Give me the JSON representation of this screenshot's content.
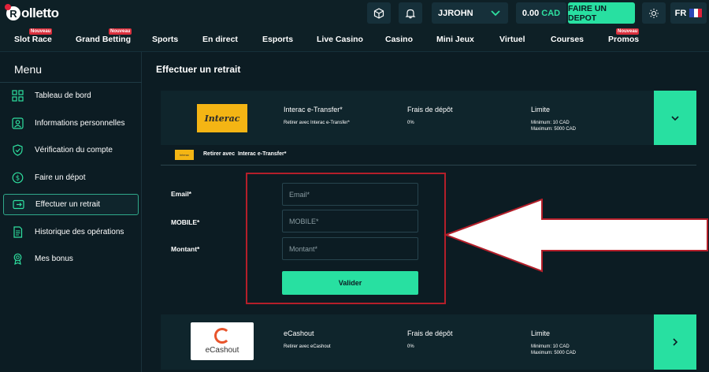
{
  "brand": {
    "logo_letter": "R",
    "logo_text": "olletto"
  },
  "topbar": {
    "username": "JJROHN",
    "balance_amount": "0.00",
    "balance_currency": "CAD",
    "deposit_label": "FAIRE UN DEPOT",
    "language": "FR"
  },
  "nav": {
    "items": [
      {
        "label": "Slot Race",
        "badge": "Nouveau"
      },
      {
        "label": "Grand Betting",
        "badge": "Nouveau"
      },
      {
        "label": "Sports"
      },
      {
        "label": "En direct"
      },
      {
        "label": "Esports"
      },
      {
        "label": "Live Casino"
      },
      {
        "label": "Casino"
      },
      {
        "label": "Mini Jeux"
      },
      {
        "label": "Virtuel"
      },
      {
        "label": "Courses"
      },
      {
        "label": "Promos",
        "badge": "Nouveau"
      }
    ]
  },
  "sidebar": {
    "title": "Menu",
    "items": [
      {
        "label": "Tableau de bord",
        "icon": "dashboard-icon"
      },
      {
        "label": "Informations personnelles",
        "icon": "profile-icon"
      },
      {
        "label": "Vérification du compte",
        "icon": "shield-check-icon"
      },
      {
        "label": "Faire un dépot",
        "icon": "dollar-circle-icon"
      },
      {
        "label": "Effectuer un retrait",
        "icon": "withdraw-icon",
        "active": true
      },
      {
        "label": "Historique des opérations",
        "icon": "history-icon"
      },
      {
        "label": "Mes bonus",
        "icon": "bonus-medal-icon"
      }
    ]
  },
  "main": {
    "title": "Effectuer un retrait",
    "methods": [
      {
        "logo_text": "Interac",
        "name": "Interac e-Transfer*",
        "sub": "Retirer avec Interac e-Transfer*",
        "fee_title": "Frais de dépôt",
        "fee_value": "0%",
        "limit_title": "Limite",
        "limit_min": "Minimum: 10 CAD",
        "limit_max": "Maximum: 5000 CAD",
        "expanded": true
      },
      {
        "logo_text": "eCashout",
        "name": "eCashout",
        "sub": "Retirer avec eCashout",
        "fee_title": "Frais de dépôt",
        "fee_value": "0%",
        "limit_title": "Limite",
        "limit_min": "Minimum: 10 CAD",
        "limit_max": "Maximum: 5000 CAD",
        "expanded": false
      }
    ],
    "subrow": {
      "logo_text": "Interac",
      "prefix": "Retirer avec",
      "name": "Interac e-Transfer*"
    },
    "form": {
      "email_label": "Email*",
      "email_placeholder": "Email*",
      "mobile_label": "MOBILE*",
      "mobile_placeholder": "MOBILE*",
      "amount_label": "Montant*",
      "amount_placeholder": "Montant*",
      "submit_label": "Valider"
    }
  },
  "colors": {
    "accent": "#28e0a1",
    "background": "#0c1c23",
    "card": "#0f252c",
    "highlight": "#b41f2a",
    "badge": "#d9303d",
    "interac": "#f4b514"
  }
}
